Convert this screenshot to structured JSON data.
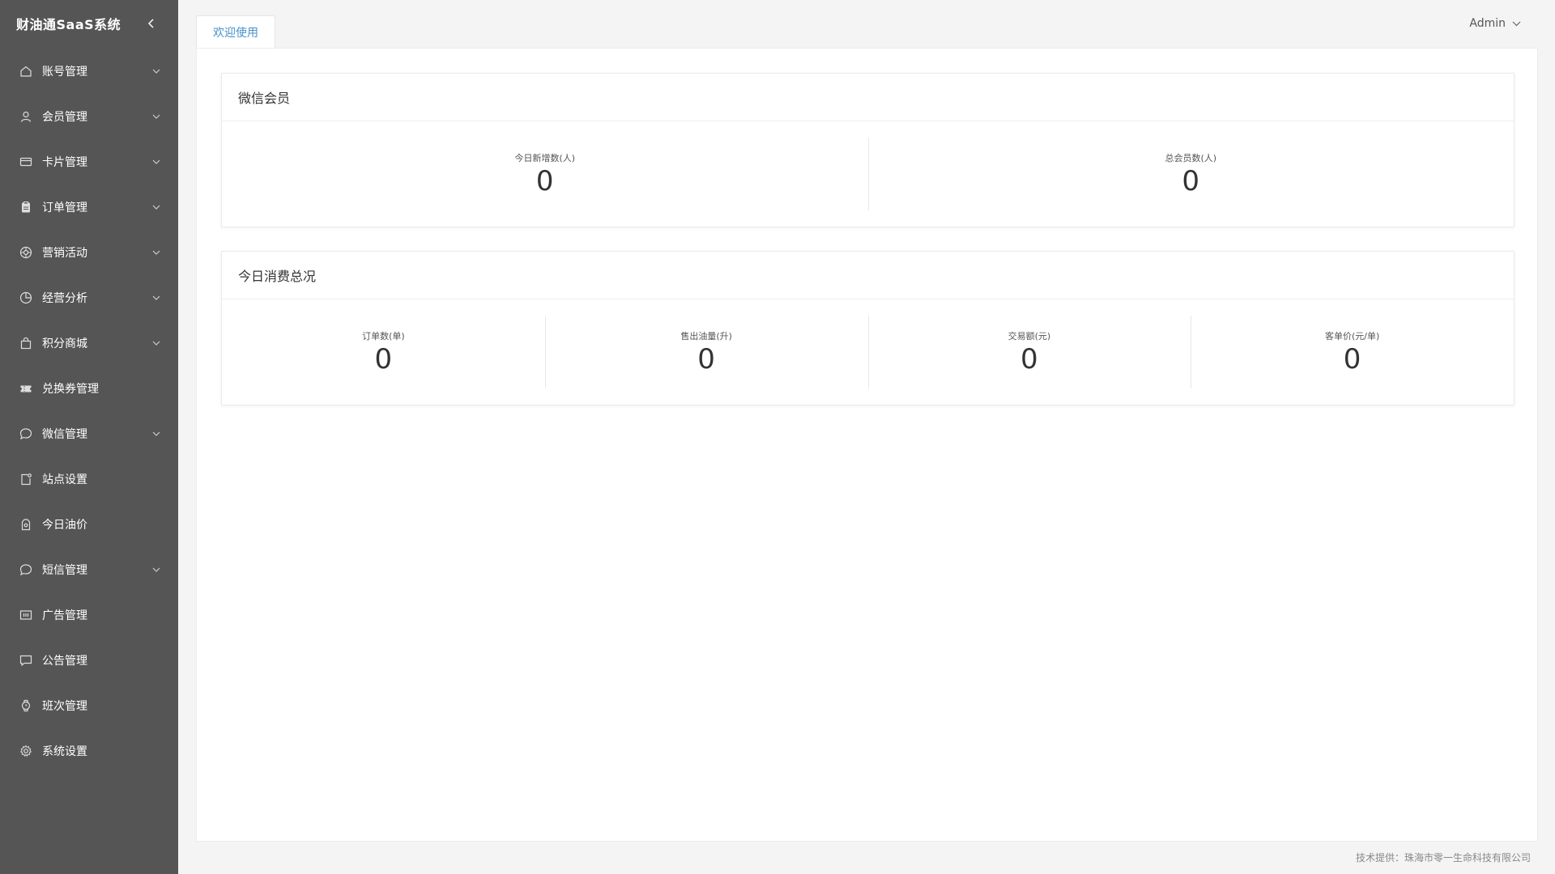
{
  "brand": {
    "title": "财油通SaaS系统"
  },
  "sidebar": {
    "items": [
      {
        "label": "账号管理",
        "icon": "home-icon",
        "has_submenu": true
      },
      {
        "label": "会员管理",
        "icon": "user-icon",
        "has_submenu": true
      },
      {
        "label": "卡片管理",
        "icon": "card-icon",
        "has_submenu": true
      },
      {
        "label": "订单管理",
        "icon": "clipboard-icon",
        "has_submenu": true
      },
      {
        "label": "营销活动",
        "icon": "aperture-icon",
        "has_submenu": true
      },
      {
        "label": "经营分析",
        "icon": "pie-chart-icon",
        "has_submenu": true
      },
      {
        "label": "积分商城",
        "icon": "shopping-bag-icon",
        "has_submenu": true
      },
      {
        "label": "兑换券管理",
        "icon": "ticket-icon",
        "has_submenu": false
      },
      {
        "label": "微信管理",
        "icon": "chat-bubble-icon",
        "has_submenu": true
      },
      {
        "label": "站点设置",
        "icon": "site-settings-icon",
        "has_submenu": false
      },
      {
        "label": "今日油价",
        "icon": "fuel-icon",
        "has_submenu": false
      },
      {
        "label": "短信管理",
        "icon": "message-circle-icon",
        "has_submenu": true
      },
      {
        "label": "广告管理",
        "icon": "ad-icon",
        "has_submenu": false
      },
      {
        "label": "公告管理",
        "icon": "announcement-icon",
        "has_submenu": false
      },
      {
        "label": "班次管理",
        "icon": "watch-icon",
        "has_submenu": false
      },
      {
        "label": "系统设置",
        "icon": "gear-icon",
        "has_submenu": false
      }
    ]
  },
  "header": {
    "tab_label": "欢迎使用",
    "user_name": "Admin"
  },
  "wechat_members": {
    "title": "微信会员",
    "stats": [
      {
        "label": "今日新增数(人)",
        "value": "0"
      },
      {
        "label": "总会员数(人)",
        "value": "0"
      }
    ]
  },
  "today_consumption": {
    "title": "今日消费总况",
    "stats": [
      {
        "label": "订单数(单)",
        "value": "0"
      },
      {
        "label": "售出油量(升)",
        "value": "0"
      },
      {
        "label": "交易额(元)",
        "value": "0"
      },
      {
        "label": "客单价(元/单)",
        "value": "0"
      }
    ]
  },
  "footer": {
    "text": "技术提供：珠海市零一生命科技有限公司"
  },
  "colors": {
    "sidebar_bg": "#555555",
    "tab_active": "#4a90c8",
    "page_bg": "#f4f4f4"
  }
}
